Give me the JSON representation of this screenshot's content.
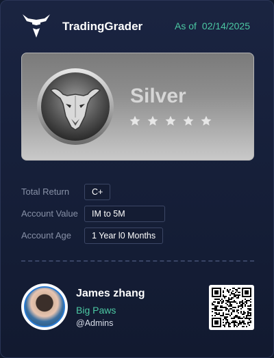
{
  "brand": {
    "name": "TradingGrader",
    "logo_icon": "bull-head-icon"
  },
  "as_of": {
    "label": "As of",
    "date": "02/14/2025"
  },
  "tier": {
    "name": "Silver",
    "medal_icon": "bull-medal-icon",
    "stars": 5,
    "colors": {
      "panel_top": "#7a7a7a",
      "panel_bottom": "#c9c9c9",
      "star": "#e6e6e6"
    }
  },
  "stats": [
    {
      "label": "Total Return",
      "value": "C+"
    },
    {
      "label": "Account Value",
      "value": "IM to 5M"
    },
    {
      "label": "Account Age",
      "value": "1 Year l0 Months"
    }
  ],
  "profile": {
    "name": "James zhang",
    "team": "Big Paws",
    "handle": "@Admins",
    "avatar_icon": "avatar",
    "qr_icon": "qr-code-icon"
  },
  "colors": {
    "accent": "#4cc9a3",
    "background": "#151e37"
  }
}
